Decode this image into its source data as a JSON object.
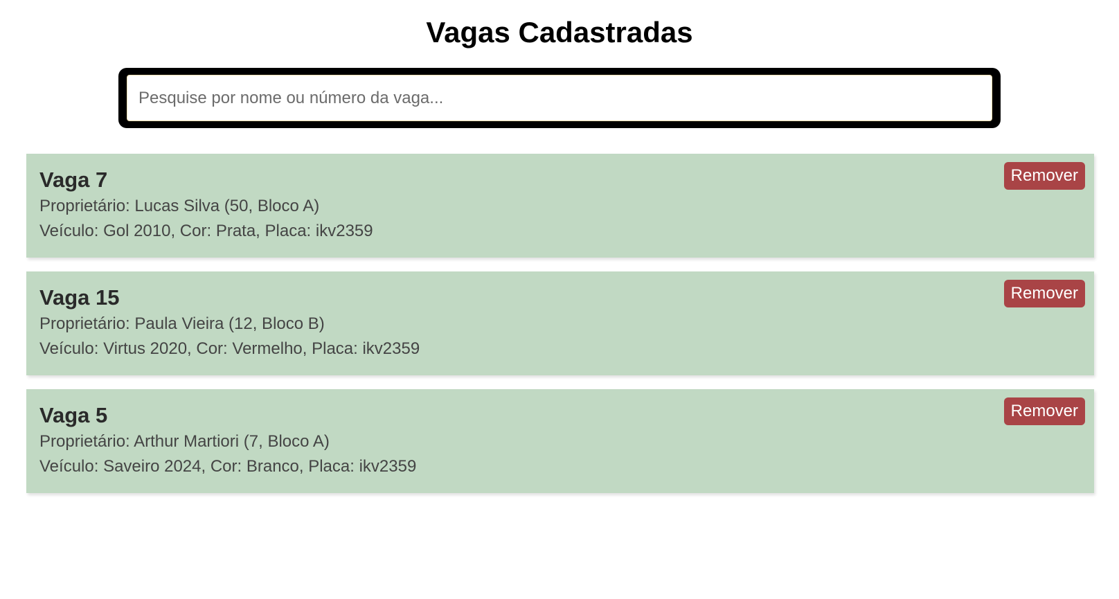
{
  "page": {
    "title": "Vagas Cadastradas"
  },
  "search": {
    "placeholder": "Pesquise por nome ou número da vaga...",
    "value": ""
  },
  "spots": [
    {
      "title": "Vaga 7",
      "owner": "Proprietário: Lucas Silva (50, Bloco A)",
      "vehicle": "Veículo: Gol 2010, Cor: Prata, Placa: ikv2359",
      "remove_label": "Remover"
    },
    {
      "title": "Vaga 15",
      "owner": "Proprietário: Paula Vieira (12, Bloco B)",
      "vehicle": "Veículo: Virtus 2020, Cor: Vermelho, Placa: ikv2359",
      "remove_label": "Remover"
    },
    {
      "title": "Vaga 5",
      "owner": "Proprietário: Arthur Martiori (7, Bloco A)",
      "vehicle": "Veículo: Saveiro 2024, Cor: Branco, Placa: ikv2359",
      "remove_label": "Remover"
    }
  ],
  "colors": {
    "card_background": "#c1d9c3",
    "remove_button": "#a94446",
    "search_frame": "#000000"
  }
}
